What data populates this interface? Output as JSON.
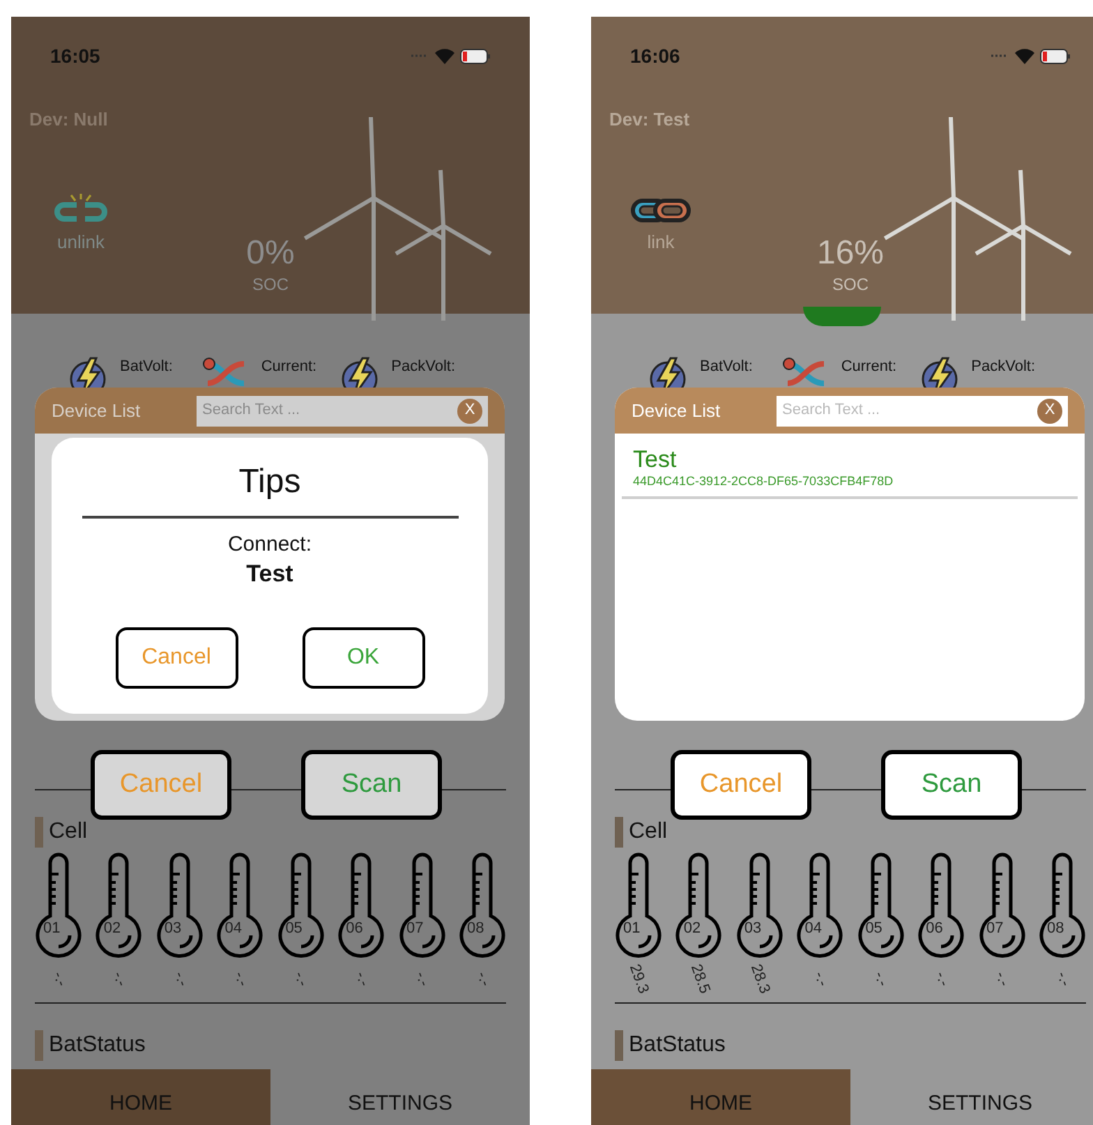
{
  "screens": [
    {
      "status_bar": {
        "time": "16:05"
      },
      "device_label": "Dev: Null",
      "link": {
        "linked": false,
        "label": "unlink"
      },
      "soc": {
        "value": "0%",
        "label": "SOC"
      },
      "metrics": [
        {
          "label": "BatVolt:",
          "kind": "voltage"
        },
        {
          "label": "Current:",
          "kind": "current"
        },
        {
          "label": "PackVolt:",
          "kind": "voltage"
        }
      ],
      "device_list": {
        "title": "Device List",
        "search": {
          "placeholder": "Search Text ..."
        },
        "clear": "X",
        "dialog": {
          "title": "Tips",
          "message": "Connect:",
          "device": "Test",
          "buttons": [
            {
              "label": "Cancel",
              "kind": "cancel"
            },
            {
              "label": "OK",
              "kind": "ok"
            }
          ]
        }
      },
      "buttons": [
        {
          "label": "Cancel",
          "kind": "cancel"
        },
        {
          "label": "Scan",
          "kind": "scan"
        }
      ],
      "cells": {
        "title": "Cell",
        "sensors": [
          {
            "label": "01",
            "value": "-.-"
          },
          {
            "label": "02",
            "value": "-.-"
          },
          {
            "label": "03",
            "value": "-.-"
          },
          {
            "label": "04",
            "value": "-.-"
          },
          {
            "label": "05",
            "value": "-.-"
          },
          {
            "label": "06",
            "value": "-.-"
          },
          {
            "label": "07",
            "value": "-.-"
          },
          {
            "label": "08",
            "value": "-.-"
          }
        ]
      },
      "status_title": "BatStatus",
      "tabs": [
        {
          "label": "HOME",
          "selected": true
        },
        {
          "label": "SETTINGS",
          "selected": false
        }
      ]
    },
    {
      "status_bar": {
        "time": "16:06"
      },
      "device_label": "Dev: Test",
      "link": {
        "linked": true,
        "label": "link"
      },
      "soc": {
        "value": "16%",
        "label": "SOC"
      },
      "metrics": [
        {
          "label": "BatVolt:",
          "kind": "voltage"
        },
        {
          "label": "Current:",
          "kind": "current"
        },
        {
          "label": "PackVolt:",
          "kind": "voltage"
        }
      ],
      "device_list": {
        "title": "Device List",
        "search": {
          "placeholder": "Search Text ..."
        },
        "clear": "X",
        "devices": [
          {
            "name": "Test",
            "id": "44D4C41C-3912-2CC8-DF65-7033CFB4F78D"
          }
        ]
      },
      "buttons": [
        {
          "label": "Cancel",
          "kind": "cancel"
        },
        {
          "label": "Scan",
          "kind": "scan"
        }
      ],
      "cells": {
        "title": "Cell",
        "sensors": [
          {
            "label": "01",
            "value": "29.3"
          },
          {
            "label": "02",
            "value": "28.5"
          },
          {
            "label": "03",
            "value": "28.3"
          },
          {
            "label": "04",
            "value": "-.-"
          },
          {
            "label": "05",
            "value": "-.-"
          },
          {
            "label": "06",
            "value": "-.-"
          },
          {
            "label": "07",
            "value": "-.-"
          },
          {
            "label": "08",
            "value": "-.-"
          }
        ]
      },
      "status_title": "BatStatus",
      "tabs": [
        {
          "label": "HOME",
          "selected": true
        },
        {
          "label": "SETTINGS",
          "selected": false
        }
      ]
    }
  ]
}
